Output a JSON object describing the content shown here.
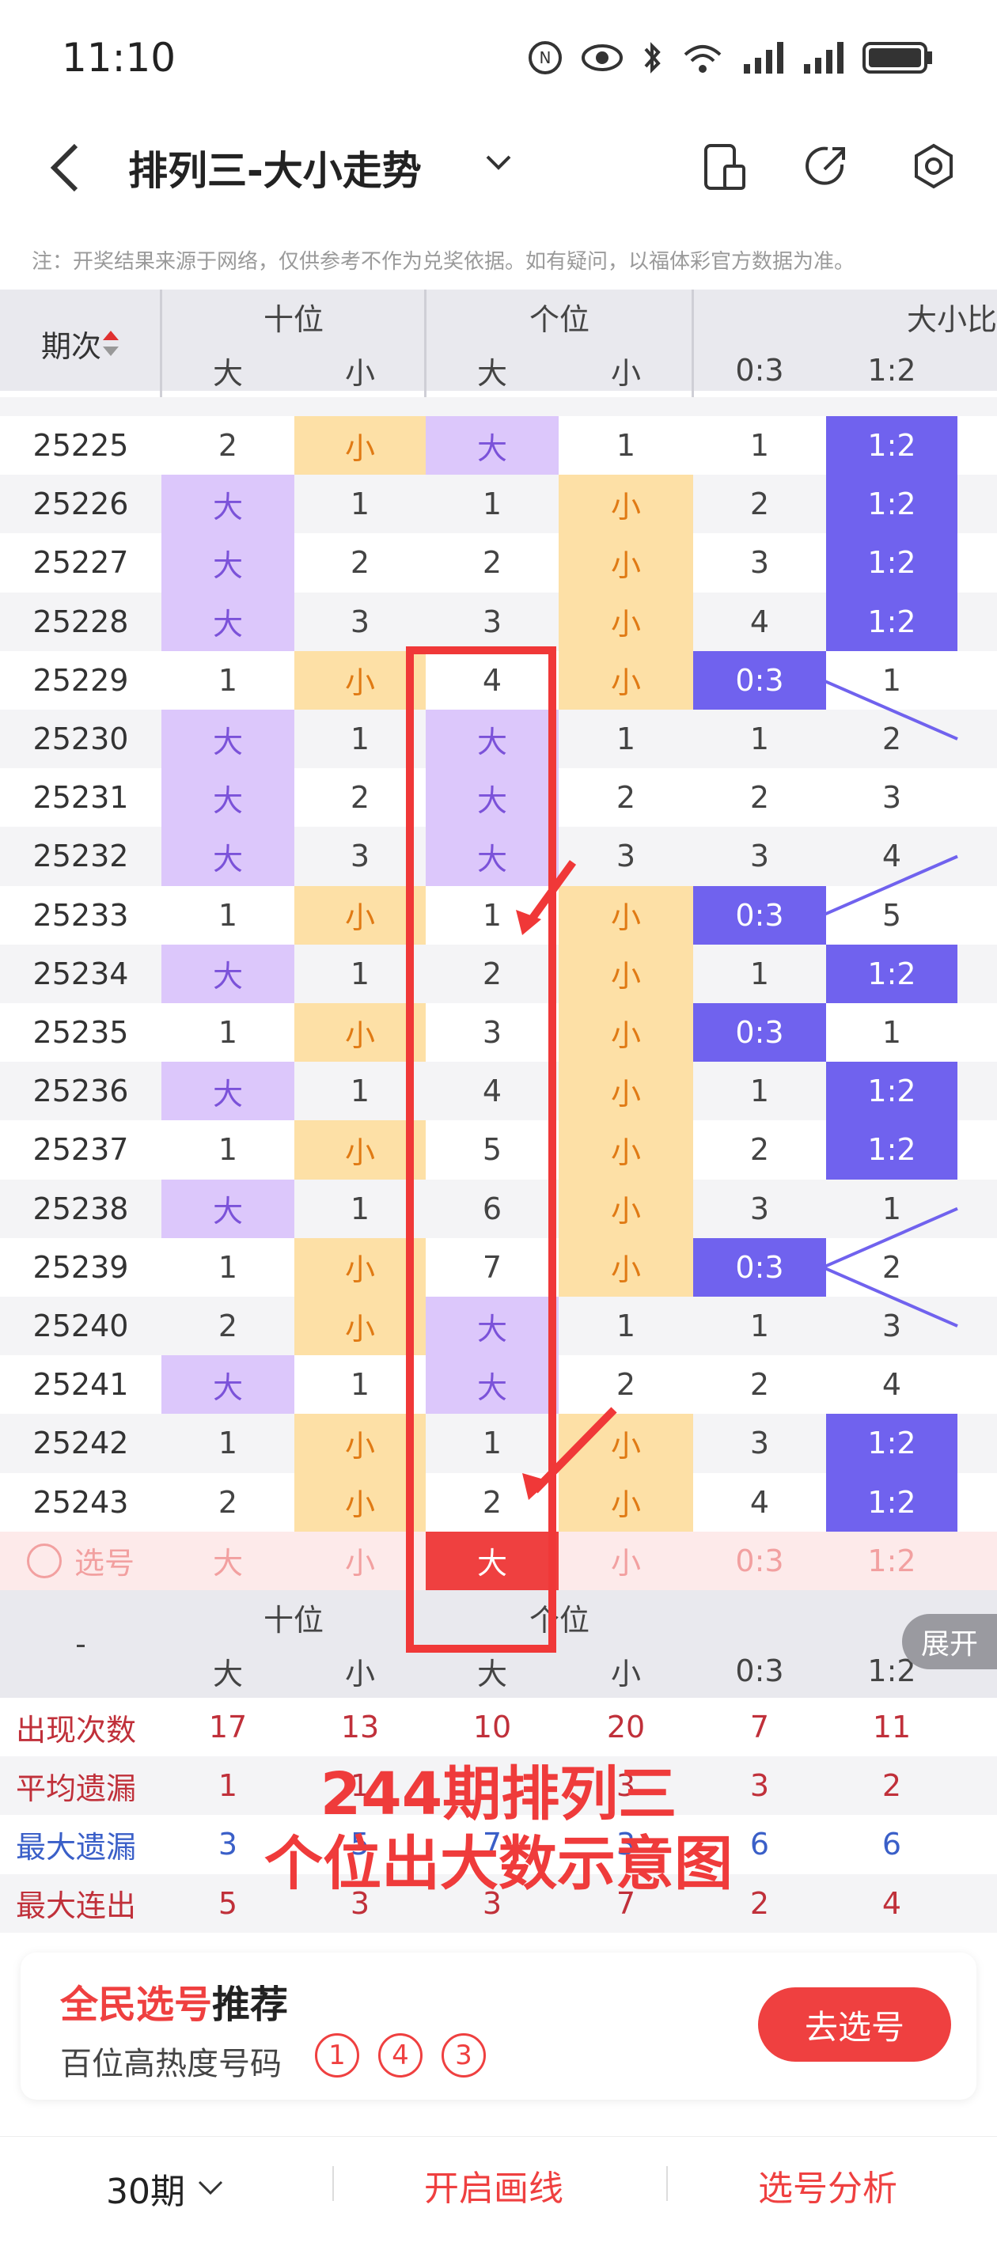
{
  "status_bar": {
    "time": "11:10"
  },
  "header": {
    "title": "排列三-大小走势"
  },
  "notice": "注：开奖结果来源于网络，仅供参考不作为兑奖依据。如有疑问，以福体彩官方数据为准。",
  "table_header": {
    "issue_label": "期次",
    "groups": [
      "十位",
      "个位",
      "大小比"
    ],
    "sub": [
      "大",
      "小",
      "大",
      "小",
      "0:3",
      "1:2"
    ]
  },
  "rows": [
    {
      "issue": "25225",
      "shi": [
        "2",
        "小"
      ],
      "ge": [
        "大",
        "1"
      ],
      "r03": "1",
      "r12": "1:2"
    },
    {
      "issue": "25226",
      "shi": [
        "大",
        "1"
      ],
      "ge": [
        "1",
        "小"
      ],
      "r03": "2",
      "r12": "1:2"
    },
    {
      "issue": "25227",
      "shi": [
        "大",
        "2"
      ],
      "ge": [
        "2",
        "小"
      ],
      "r03": "3",
      "r12": "1:2"
    },
    {
      "issue": "25228",
      "shi": [
        "大",
        "3"
      ],
      "ge": [
        "3",
        "小"
      ],
      "r03": "4",
      "r12": "1:2"
    },
    {
      "issue": "25229",
      "shi": [
        "1",
        "小"
      ],
      "ge": [
        "4",
        "小"
      ],
      "r03": "0:3",
      "r12": "1"
    },
    {
      "issue": "25230",
      "shi": [
        "大",
        "1"
      ],
      "ge": [
        "大",
        "1"
      ],
      "r03": "1",
      "r12": "2"
    },
    {
      "issue": "25231",
      "shi": [
        "大",
        "2"
      ],
      "ge": [
        "大",
        "2"
      ],
      "r03": "2",
      "r12": "3"
    },
    {
      "issue": "25232",
      "shi": [
        "大",
        "3"
      ],
      "ge": [
        "大",
        "3"
      ],
      "r03": "3",
      "r12": "4"
    },
    {
      "issue": "25233",
      "shi": [
        "1",
        "小"
      ],
      "ge": [
        "1",
        "小"
      ],
      "r03": "0:3",
      "r12": "5"
    },
    {
      "issue": "25234",
      "shi": [
        "大",
        "1"
      ],
      "ge": [
        "2",
        "小"
      ],
      "r03": "1",
      "r12": "1:2"
    },
    {
      "issue": "25235",
      "shi": [
        "1",
        "小"
      ],
      "ge": [
        "3",
        "小"
      ],
      "r03": "0:3",
      "r12": "1"
    },
    {
      "issue": "25236",
      "shi": [
        "大",
        "1"
      ],
      "ge": [
        "4",
        "小"
      ],
      "r03": "1",
      "r12": "1:2"
    },
    {
      "issue": "25237",
      "shi": [
        "1",
        "小"
      ],
      "ge": [
        "5",
        "小"
      ],
      "r03": "2",
      "r12": "1:2"
    },
    {
      "issue": "25238",
      "shi": [
        "大",
        "1"
      ],
      "ge": [
        "6",
        "小"
      ],
      "r03": "3",
      "r12": "1"
    },
    {
      "issue": "25239",
      "shi": [
        "1",
        "小"
      ],
      "ge": [
        "7",
        "小"
      ],
      "r03": "0:3",
      "r12": "2"
    },
    {
      "issue": "25240",
      "shi": [
        "2",
        "小"
      ],
      "ge": [
        "大",
        "1"
      ],
      "r03": "1",
      "r12": "3"
    },
    {
      "issue": "25241",
      "shi": [
        "大",
        "1"
      ],
      "ge": [
        "大",
        "2"
      ],
      "r03": "2",
      "r12": "4"
    },
    {
      "issue": "25242",
      "shi": [
        "1",
        "小"
      ],
      "ge": [
        "1",
        "小"
      ],
      "r03": "3",
      "r12": "1:2"
    },
    {
      "issue": "25243",
      "shi": [
        "2",
        "小"
      ],
      "ge": [
        "2",
        "小"
      ],
      "r03": "4",
      "r12": "1:2"
    }
  ],
  "select_row": {
    "label": "选号",
    "cells": [
      "大",
      "小",
      "大",
      "小",
      "0:3",
      "1:2"
    ]
  },
  "bottom_header": {
    "dash": "-",
    "groups": [
      "十位",
      "个位"
    ],
    "sub": [
      "大",
      "小",
      "大",
      "小",
      "0:3",
      "1:2"
    ],
    "expand": "展开"
  },
  "stats": [
    {
      "label": "出现次数",
      "color": "#c0303a",
      "values": [
        "17",
        "13",
        "10",
        "20",
        "7",
        "11"
      ]
    },
    {
      "label": "平均遗漏",
      "color": "#c0303a",
      "values": [
        "1",
        "1",
        "",
        "3",
        "3",
        "2"
      ]
    },
    {
      "label": "最大遗漏",
      "color": "#3a5fc8",
      "values": [
        "3",
        "5",
        "7",
        "3",
        "6",
        "6"
      ]
    },
    {
      "label": "最大连出",
      "color": "#c0303a",
      "values": [
        "5",
        "3",
        "3",
        "7",
        "2",
        "4"
      ]
    }
  ],
  "overlay": {
    "line1": "244期排列三",
    "line2": "个位出大数示意图"
  },
  "recommend": {
    "title_red": "全民选号",
    "title_black": "推荐",
    "subtitle": "百位高热度号码",
    "balls": [
      "1",
      "4",
      "3"
    ],
    "button": "去选号"
  },
  "tabbar": {
    "period": "30期",
    "draw": "开启画线",
    "analysis": "选号分析"
  },
  "colors": {
    "accent": "#ef4040",
    "big": "#dcc7fb",
    "small": "#fde0a6",
    "ratio": "#7062ee"
  }
}
